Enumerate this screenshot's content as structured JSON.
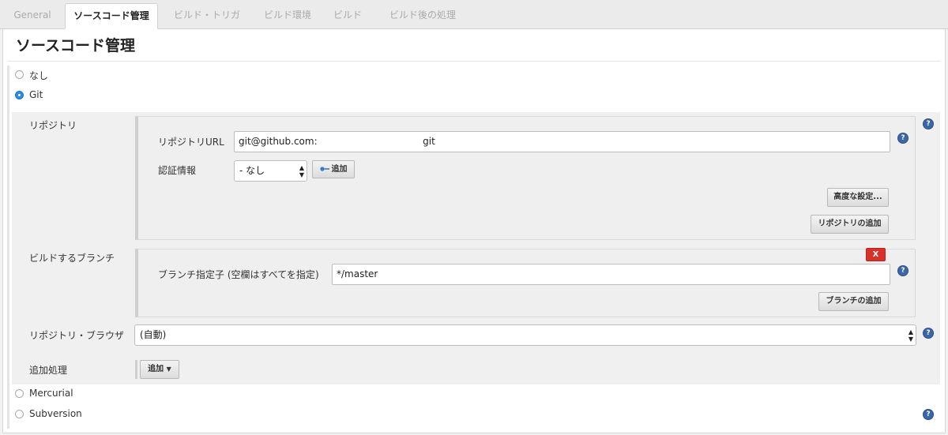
{
  "tabs": [
    {
      "label": "General",
      "active": false
    },
    {
      "label": "ソースコード管理",
      "active": true
    },
    {
      "label": "ビルド・トリガ",
      "active": false
    },
    {
      "label": "ビルド環境",
      "active": false
    },
    {
      "label": "ビルド",
      "active": false
    },
    {
      "label": "ビルド後の処理",
      "active": false
    }
  ],
  "page_title": "ソースコード管理",
  "scm_options": {
    "none": {
      "label": "なし",
      "checked": false
    },
    "git": {
      "label": "Git",
      "checked": true
    },
    "mercurial": {
      "label": "Mercurial",
      "checked": false
    },
    "subversion": {
      "label": "Subversion",
      "checked": false
    }
  },
  "repository": {
    "section_label": "リポジトリ",
    "url_label": "リポジトリURL",
    "url_value": "git@github.com:                                   git",
    "credentials_label": "認証情報",
    "credentials_value": "- なし",
    "add_button": "追加",
    "advanced_button": "高度な設定...",
    "add_repository_button": "リポジトリの追加"
  },
  "branches": {
    "section_label": "ビルドするブランチ",
    "delete_button": "X",
    "specifier_label": "ブランチ指定子 (空欄はすべてを指定)",
    "specifier_value": "*/master",
    "add_branch_button": "ブランチの追加"
  },
  "browser": {
    "label": "リポジトリ・ブラウザ",
    "value": "(自動)"
  },
  "additional": {
    "label": "追加処理",
    "add_button": "追加"
  },
  "help_icon_text": "?",
  "colors": {
    "accent": "#2d8ce0",
    "help": "#3b66a8",
    "delete": "#d9312a"
  }
}
